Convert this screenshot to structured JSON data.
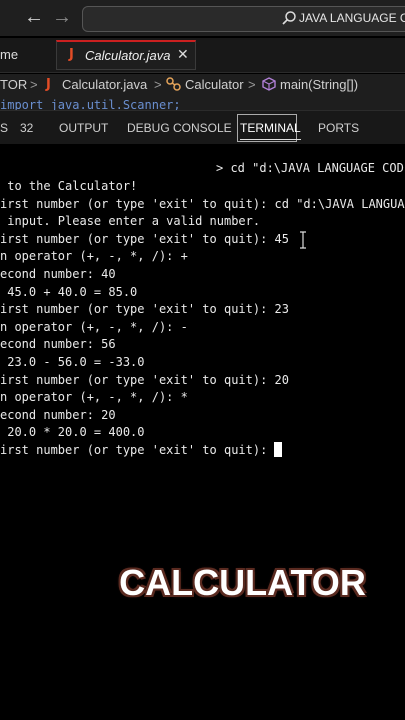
{
  "titlebar": {
    "back_arrow": "←",
    "forward_arrow": "→",
    "search_text": "JAVA LANGUAGE CODE"
  },
  "tabs": {
    "home_label": "me",
    "active_tab": "Calculator.java",
    "active_tab_icon": "J",
    "close_glyph": "✕"
  },
  "breadcrumb": {
    "part1": "TOR",
    "part2_icon": "J",
    "part2": "Calculator.java",
    "part3": "Calculator",
    "part4": "main(String[])",
    "separator": ">"
  },
  "code_peek": "import java.util.Scanner;",
  "panel_tabs": {
    "problems": "S",
    "problems_count": "32",
    "output": "OUTPUT",
    "debug": "DEBUG CONSOLE",
    "terminal": "TERMINAL",
    "ports": "PORTS"
  },
  "terminal": {
    "prompt": "> cd \"d:\\JAVA LANGUAGE CODE",
    "lines": [
      " to the Calculator!",
      "irst number (or type 'exit' to quit): cd \"d:\\JAVA LANGUAGE",
      " input. Please enter a valid number.",
      "irst number (or type 'exit' to quit): 45",
      "n operator (+, -, *, /): +",
      "econd number: 40",
      " 45.0 + 40.0 = 85.0",
      "irst number (or type 'exit' to quit): 23",
      "n operator (+, -, *, /): -",
      "econd number: 56",
      " 23.0 - 56.0 = -33.0",
      "irst number (or type 'exit' to quit): 20",
      "n operator (+, -, *, /): *",
      "econd number: 20",
      " 20.0 * 20.0 = 400.0",
      "irst number (or type 'exit' to quit): "
    ]
  },
  "overlay": {
    "title": "CALCULATOR"
  },
  "colors": {
    "java_icon": "#e34c26",
    "tab_accent": "#cc2020",
    "background": "#000000"
  }
}
